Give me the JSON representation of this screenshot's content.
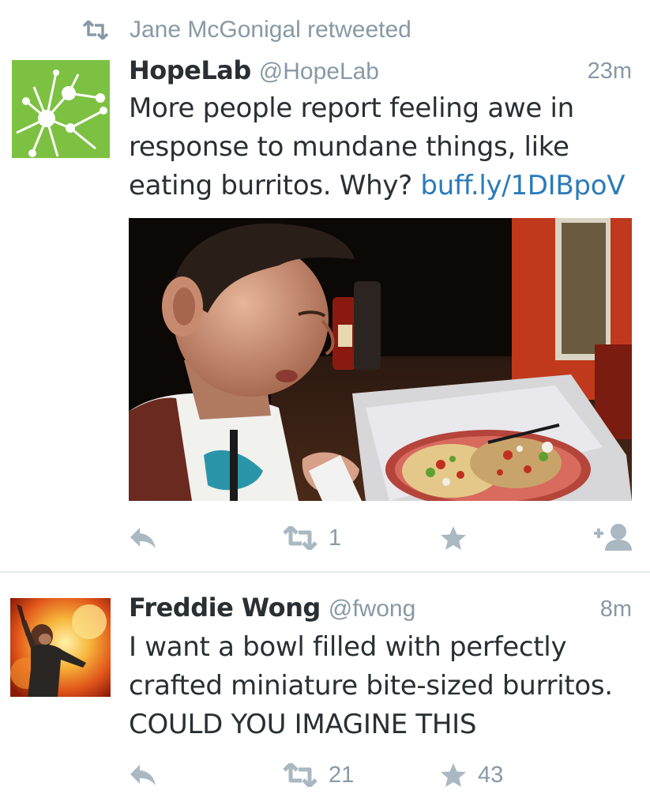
{
  "timeline": {
    "tweets": [
      {
        "context": "Jane McGonigal retweeted",
        "display_name": "HopeLab",
        "handle": "@HopeLab",
        "time": "23m",
        "text": "More people report feeling awe in response to mundane things, like eating burritos. Why?",
        "text_lines": [
          "More people report feeling awe in",
          "response to mundane things, like",
          "eating burritos. Why? "
        ],
        "link": "buff.ly/1DIBpoV",
        "avatar_color": "#7dc142",
        "actions": {
          "reply_icon": "reply-icon",
          "retweet_count": "1",
          "favorite_icon": "star-icon",
          "follow_icon": "follow-icon"
        }
      },
      {
        "display_name": "Freddie Wong",
        "handle": "@fwong",
        "time": "8m",
        "text_lines": [
          "I want a bowl filled with perfectly",
          "crafted miniature bite-sized burritos.",
          "COULD YOU IMAGINE THIS"
        ],
        "actions": {
          "reply_icon": "reply-icon",
          "retweet_count": "21",
          "favorite_count": "43"
        }
      }
    ]
  },
  "colors": {
    "link": "#2b7bb9",
    "secondary_text": "#8899a6",
    "action_icon": "#aab8c2",
    "divider": "#e1e8ed"
  }
}
